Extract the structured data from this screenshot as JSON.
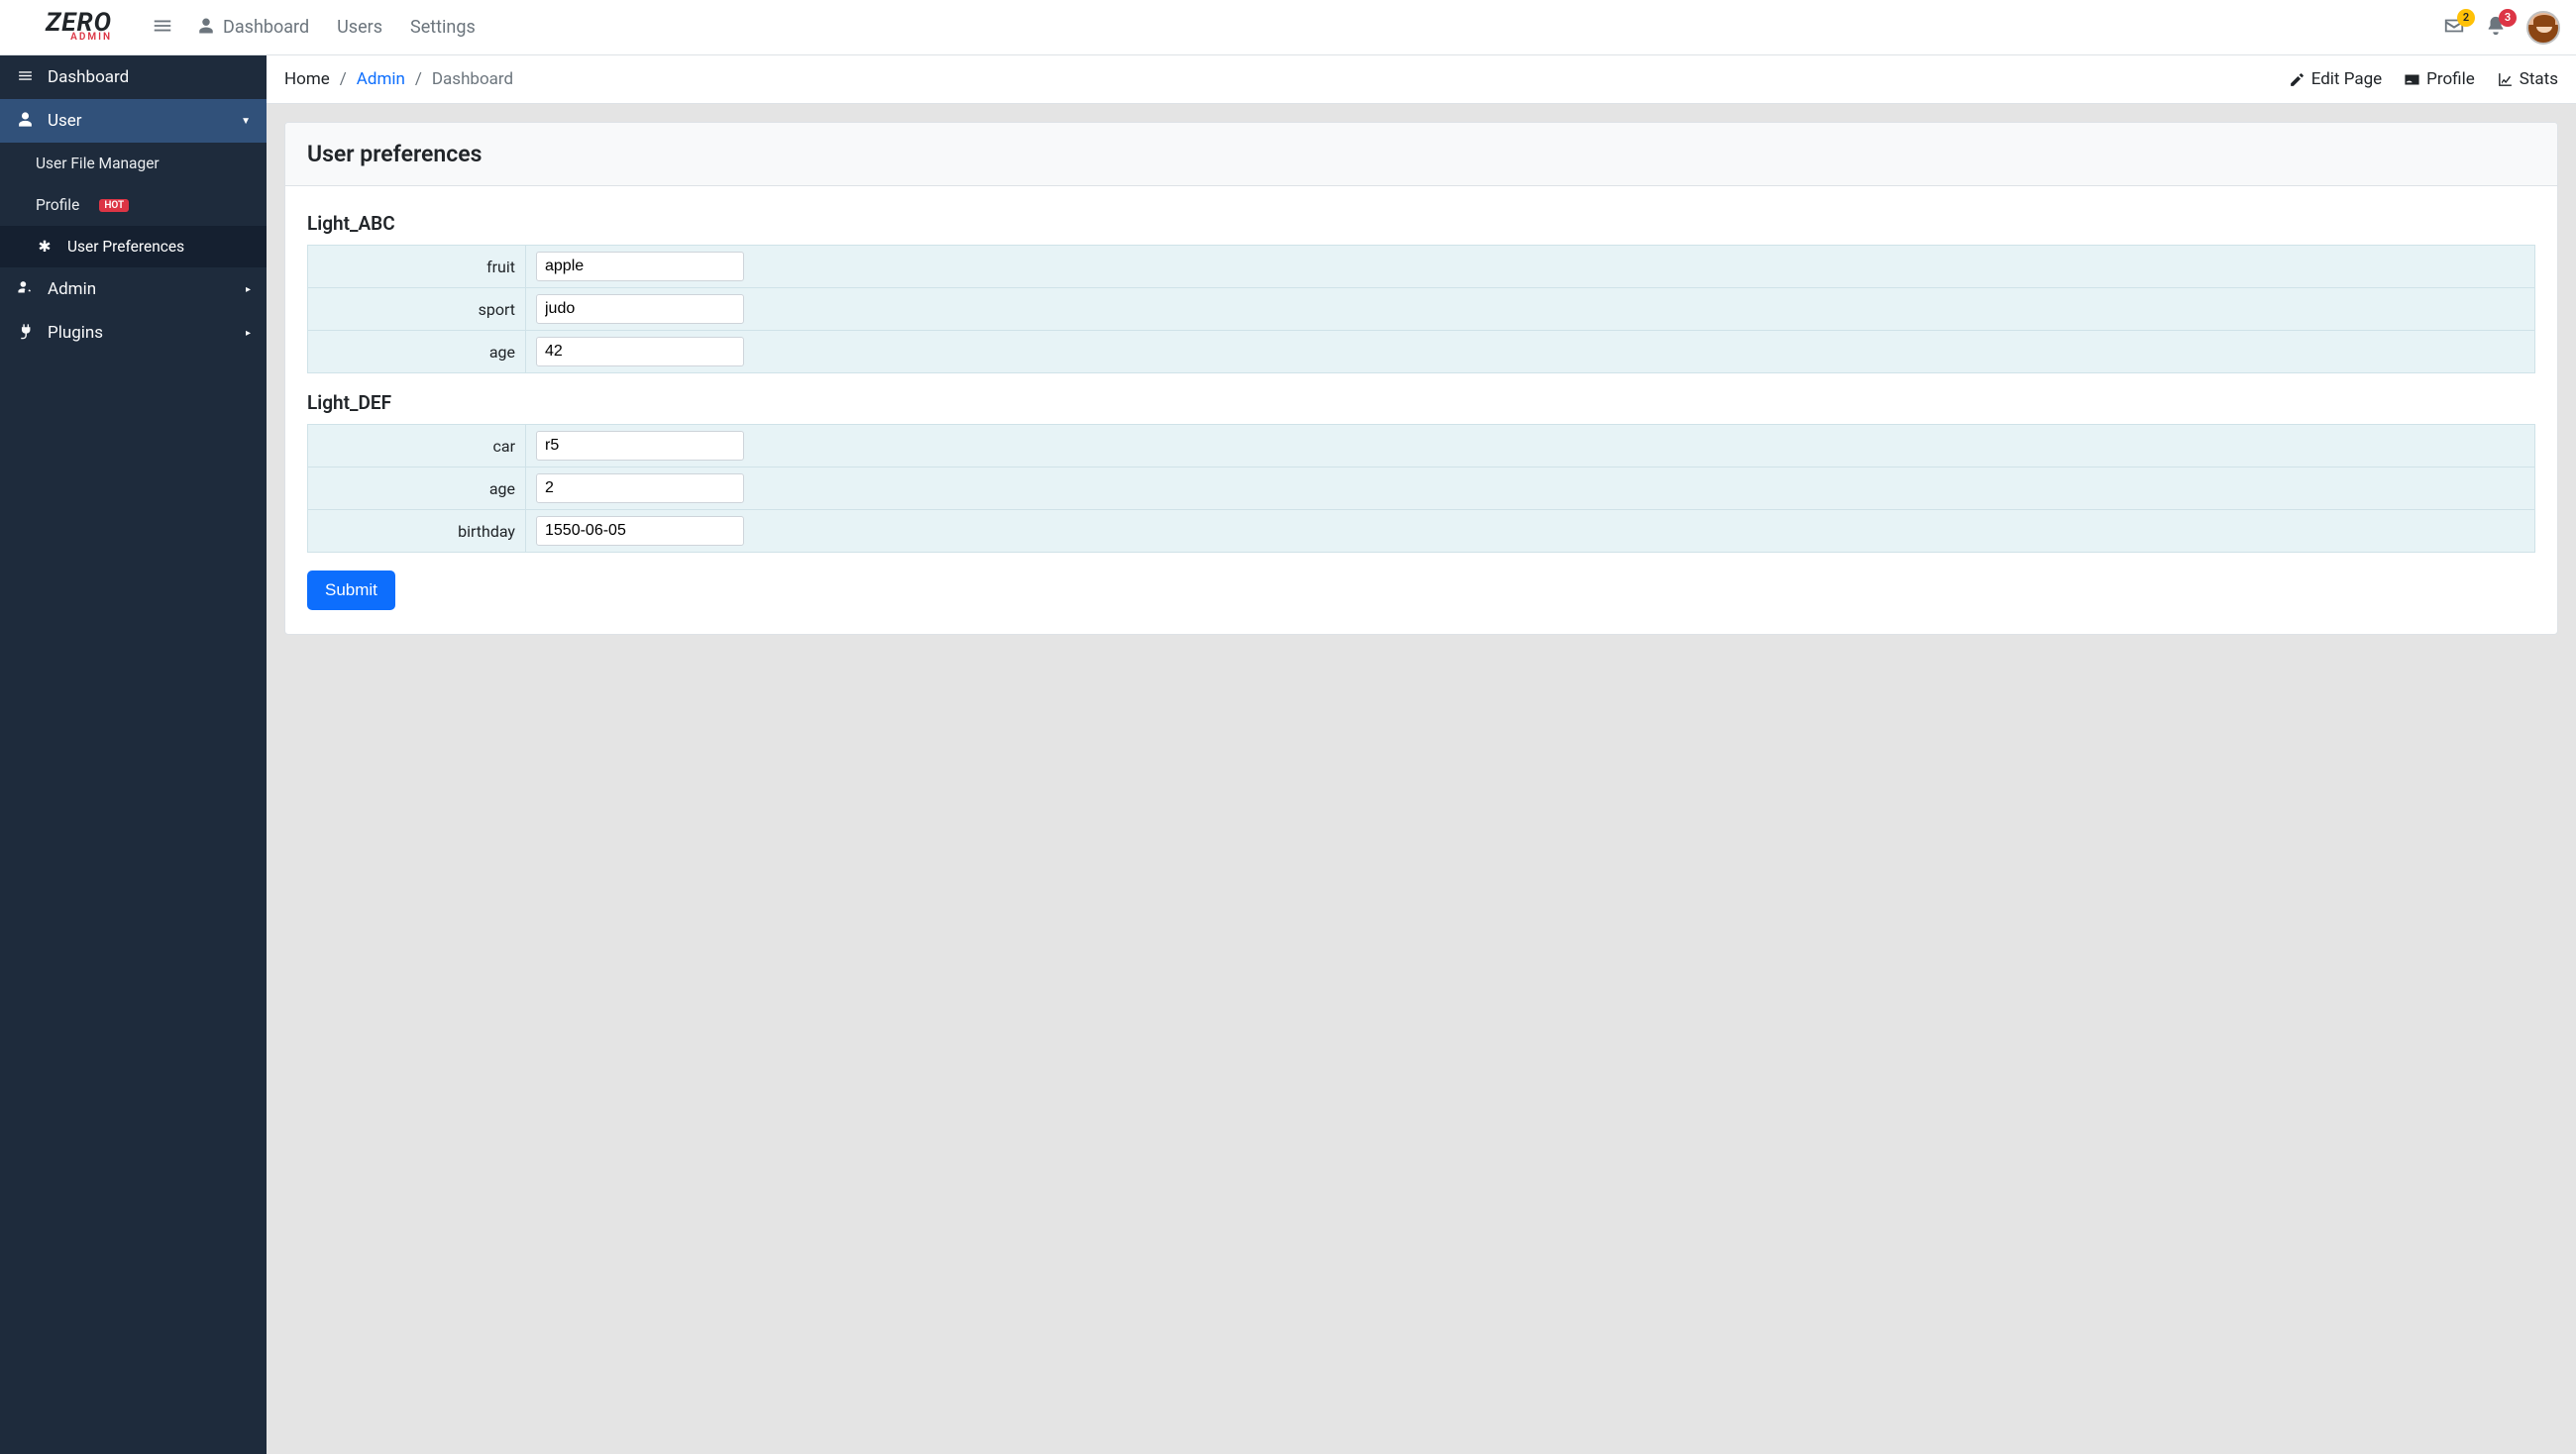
{
  "brand": {
    "main": "ZERO",
    "sub": "ADMIN"
  },
  "topnav": {
    "items": [
      {
        "label": "Dashboard"
      },
      {
        "label": "Users"
      },
      {
        "label": "Settings"
      }
    ]
  },
  "notifications": {
    "mail_count": "2",
    "alert_count": "3"
  },
  "sidebar": {
    "items": [
      {
        "label": "Dashboard"
      },
      {
        "label": "User"
      },
      {
        "label": "Admin"
      },
      {
        "label": "Plugins"
      }
    ],
    "user_sub": [
      {
        "label": "User File Manager"
      },
      {
        "label": "Profile",
        "badge": "HOT"
      },
      {
        "label": "User Preferences"
      }
    ]
  },
  "breadcrumb": {
    "home": "Home",
    "admin": "Admin",
    "current": "Dashboard"
  },
  "header_actions": {
    "edit": "Edit Page",
    "profile": "Profile",
    "stats": "Stats"
  },
  "card": {
    "title": "User preferences"
  },
  "sections": [
    {
      "title": "Light_ABC",
      "rows": [
        {
          "label": "fruit",
          "value": "apple",
          "type": "text"
        },
        {
          "label": "sport",
          "value": "judo",
          "type": "text"
        },
        {
          "label": "age",
          "value": "42",
          "type": "number"
        }
      ]
    },
    {
      "title": "Light_DEF",
      "rows": [
        {
          "label": "car",
          "value": "r5",
          "type": "text"
        },
        {
          "label": "age",
          "value": "2",
          "type": "number"
        },
        {
          "label": "birthday",
          "value": "1550-06-05",
          "type": "text"
        }
      ]
    }
  ],
  "submit_label": "Submit"
}
